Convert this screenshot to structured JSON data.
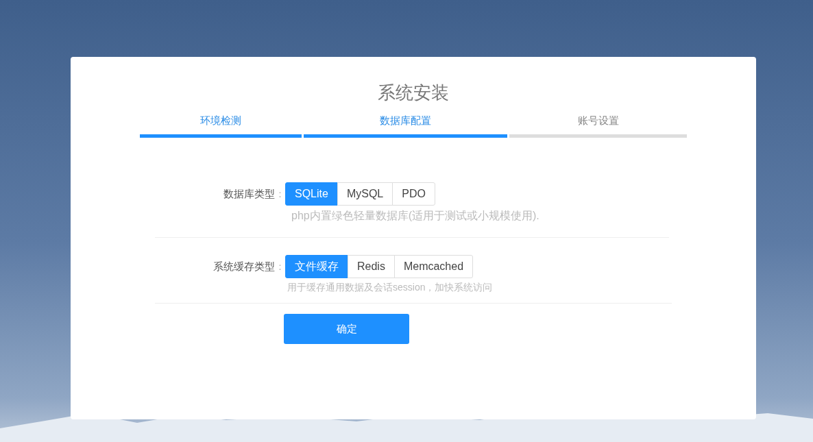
{
  "title": "系统安装",
  "steps": [
    {
      "label": "环境检测",
      "done": true
    },
    {
      "label": "数据库配置",
      "done": true
    },
    {
      "label": "账号设置",
      "done": false
    }
  ],
  "fields": [
    {
      "label": "数据库类型",
      "colon": "：",
      "options": [
        {
          "label": "SQLite",
          "selected": true
        },
        {
          "label": "MySQL",
          "selected": false
        },
        {
          "label": "PDO",
          "selected": false
        }
      ],
      "hint": "php内置绿色轻量数据库(适用于测试或小规模使用)."
    },
    {
      "label": "系统缓存类型",
      "colon": "：",
      "options": [
        {
          "label": "文件缓存",
          "selected": true
        },
        {
          "label": "Redis",
          "selected": false
        },
        {
          "label": "Memcached",
          "selected": false
        }
      ],
      "hint": "用于缓存通用数据及会话session，加快系统访问"
    }
  ],
  "submit": "确定"
}
